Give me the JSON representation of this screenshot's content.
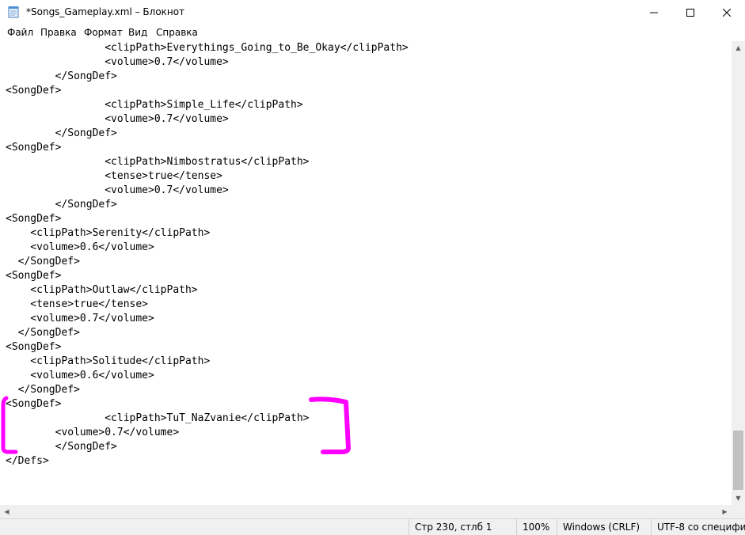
{
  "window": {
    "title": "*Songs_Gameplay.xml – Блокнот",
    "app_icon": "notepad-icon",
    "controls": [
      "minimize-icon",
      "maximize-icon",
      "close-icon"
    ]
  },
  "menu": [
    "Файл",
    "Правка",
    "Формат",
    "Вид",
    "Справка"
  ],
  "editor": {
    "lines": [
      "                <clipPath>Everythings_Going_to_Be_Okay</clipPath>",
      "                <volume>0.7</volume>",
      "        </SongDef>",
      "<SongDef>",
      "                <clipPath>Simple_Life</clipPath>",
      "                <volume>0.7</volume>",
      "        </SongDef>",
      "<SongDef>",
      "                <clipPath>Nimbostratus</clipPath>",
      "                <tense>true</tense>",
      "                <volume>0.7</volume>",
      "        </SongDef>",
      "<SongDef>",
      "    <clipPath>Serenity</clipPath>",
      "    <volume>0.6</volume>",
      "  </SongDef>",
      "<SongDef>",
      "    <clipPath>Outlaw</clipPath>",
      "    <tense>true</tense>",
      "    <volume>0.7</volume>",
      "  </SongDef>",
      "<SongDef>",
      "    <clipPath>Solitude</clipPath>",
      "    <volume>0.6</volume>",
      "  </SongDef>",
      "<SongDef>",
      "                <clipPath>TuT_NaZvanie</clipPath>",
      "        <volume>0.7</volume>",
      "        </SongDef>",
      "</Defs>"
    ]
  },
  "status": {
    "position": "Стр 230, стлб 1",
    "zoom": "100%",
    "line_endings": "Windows (CRLF)",
    "encoding": "UTF-8 со специфи"
  },
  "annotation_color": "#ff00ff"
}
